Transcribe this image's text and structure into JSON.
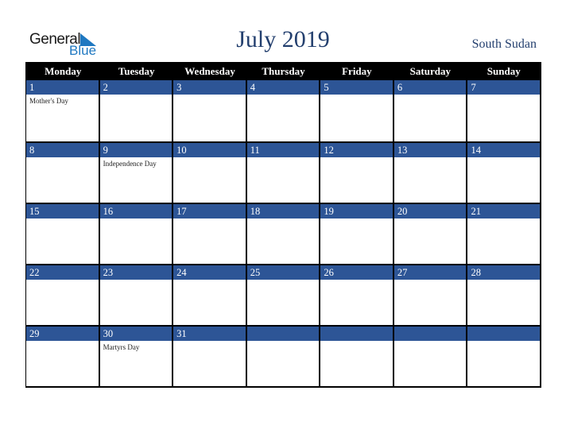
{
  "logo": {
    "general": "General",
    "blue": "Blue"
  },
  "title": "July 2019",
  "country": "South Sudan",
  "colors": {
    "band": "#2d5596",
    "header": "#000000",
    "title": "#233f6e",
    "logo_blue": "#1f78c1"
  },
  "weekdays": [
    "Monday",
    "Tuesday",
    "Wednesday",
    "Thursday",
    "Friday",
    "Saturday",
    "Sunday"
  ],
  "weeks": [
    [
      {
        "day": "1",
        "holiday": "Mother's Day"
      },
      {
        "day": "2",
        "holiday": ""
      },
      {
        "day": "3",
        "holiday": ""
      },
      {
        "day": "4",
        "holiday": ""
      },
      {
        "day": "5",
        "holiday": ""
      },
      {
        "day": "6",
        "holiday": ""
      },
      {
        "day": "7",
        "holiday": ""
      }
    ],
    [
      {
        "day": "8",
        "holiday": ""
      },
      {
        "day": "9",
        "holiday": "Independence Day"
      },
      {
        "day": "10",
        "holiday": ""
      },
      {
        "day": "11",
        "holiday": ""
      },
      {
        "day": "12",
        "holiday": ""
      },
      {
        "day": "13",
        "holiday": ""
      },
      {
        "day": "14",
        "holiday": ""
      }
    ],
    [
      {
        "day": "15",
        "holiday": ""
      },
      {
        "day": "16",
        "holiday": ""
      },
      {
        "day": "17",
        "holiday": ""
      },
      {
        "day": "18",
        "holiday": ""
      },
      {
        "day": "19",
        "holiday": ""
      },
      {
        "day": "20",
        "holiday": ""
      },
      {
        "day": "21",
        "holiday": ""
      }
    ],
    [
      {
        "day": "22",
        "holiday": ""
      },
      {
        "day": "23",
        "holiday": ""
      },
      {
        "day": "24",
        "holiday": ""
      },
      {
        "day": "25",
        "holiday": ""
      },
      {
        "day": "26",
        "holiday": ""
      },
      {
        "day": "27",
        "holiday": ""
      },
      {
        "day": "28",
        "holiday": ""
      }
    ],
    [
      {
        "day": "29",
        "holiday": ""
      },
      {
        "day": "30",
        "holiday": "Martyrs Day"
      },
      {
        "day": "31",
        "holiday": ""
      },
      {
        "day": "",
        "holiday": ""
      },
      {
        "day": "",
        "holiday": ""
      },
      {
        "day": "",
        "holiday": ""
      },
      {
        "day": "",
        "holiday": ""
      }
    ]
  ]
}
